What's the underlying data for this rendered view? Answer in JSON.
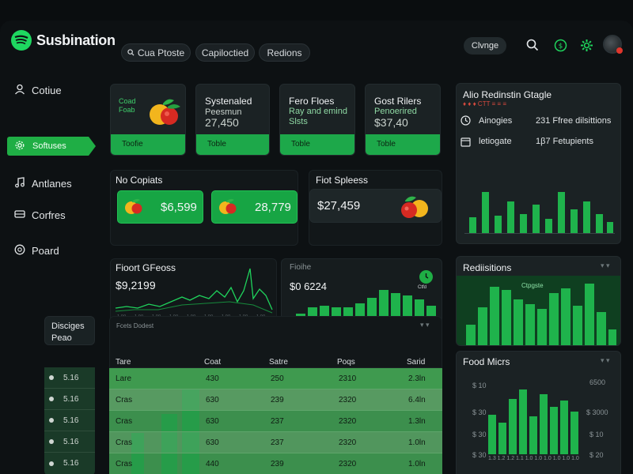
{
  "app": {
    "name": "Susbination"
  },
  "header": {
    "search_pill": "Cua Ptoste",
    "pills": [
      "Capiloctied",
      "Redions"
    ],
    "change_label": "Clvnge"
  },
  "sidebar": {
    "items": [
      {
        "label": "Cotiue",
        "icon": "user-icon"
      },
      {
        "label": "Softuses",
        "icon": "gear-icon",
        "active": true
      },
      {
        "label": "Antlanes",
        "icon": "music-icon"
      },
      {
        "label": "Corfres",
        "icon": "drive-icon"
      },
      {
        "label": "Poard",
        "icon": "globe-icon"
      }
    ]
  },
  "top_cards": [
    {
      "title": "Coad",
      "sub": "Foab",
      "foot": "Toofie"
    },
    {
      "title": "Systenaled",
      "sub": "Peesmun",
      "value": "27,450",
      "foot": "Toble"
    },
    {
      "title": "Fero Floes",
      "sub": "Ray and emind",
      "value": "Slsts",
      "foot": "Toble"
    },
    {
      "title": "Gost Rilers",
      "sub": "Penoerired",
      "value": "$37,40",
      "foot": "Toble"
    }
  ],
  "no_copiats": {
    "title": "No Copiats",
    "values": [
      "$6,599",
      "28,779"
    ]
  },
  "fiot_spleess": {
    "title": "Fiot Spleess",
    "value": "$27,459"
  },
  "fioort": {
    "title": "Fioort GFeoss",
    "value": "$9,2199"
  },
  "mini_bars_panel": {
    "title": "Fioihe",
    "value": "$0 6224",
    "badge": "Ctfd"
  },
  "right_top": {
    "title": "Alio Redinstin Gtagle",
    "subtitle": "♦ ♦ ♦ CTT ≡ ≡ ≡",
    "rows": [
      {
        "label": "Ainogies",
        "value": "231 Ffree dilsittions"
      },
      {
        "label": "letiogate",
        "value": "1β7 Fetupients"
      }
    ]
  },
  "rediisitions": {
    "title": "Rediisitions",
    "label": "Ctpgste"
  },
  "food_micrs": {
    "title": "Food Micrs",
    "left_ticks": [
      "$ 10",
      "$ 30",
      "$ 30",
      "$ 30"
    ],
    "right_ticks": [
      "6500",
      "$ 3000",
      "$ 10",
      "$ 20"
    ],
    "x_ticks": "1.3 1.2 1.2 1.1 1.0 1.0 1.0 1.0 1.0 1.0"
  },
  "side_list": {
    "title": "Disciges",
    "sub": "Peao",
    "items": [
      "5.16",
      "5.16",
      "5.16",
      "5.16",
      "5.16"
    ]
  },
  "table": {
    "caption": "Fcets Dodest",
    "headers": [
      "Tare",
      "Coat",
      "Satre",
      "Poqs",
      "Sarid"
    ],
    "rows": [
      [
        "Lare",
        "430",
        "250",
        "2310",
        "2.3ln"
      ],
      [
        "Cras",
        "630",
        "239",
        "2320",
        "6.4ln"
      ],
      [
        "Cras",
        "630",
        "237",
        "2320",
        "1.3ln"
      ],
      [
        "Cras",
        "630",
        "237",
        "2320",
        "1.0ln"
      ],
      [
        "Cras",
        "440",
        "239",
        "2320",
        "1.0ln"
      ]
    ]
  },
  "colors": {
    "accent": "#1fb34c",
    "background": "#0d1113",
    "card": "#1b2224"
  }
}
